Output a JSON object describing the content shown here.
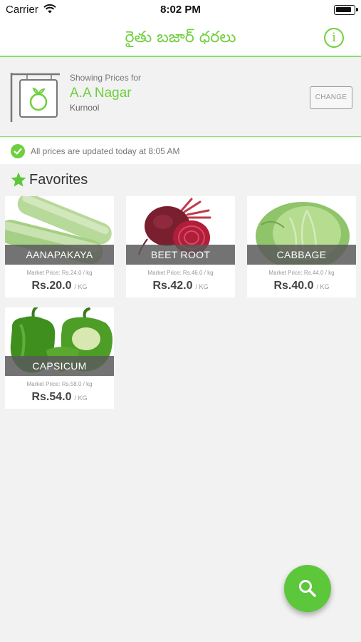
{
  "status_bar": {
    "carrier": "Carrier",
    "time": "8:02 PM"
  },
  "header": {
    "title": "రైతు బజార్ ధరలు",
    "info_icon": "info-icon"
  },
  "location": {
    "caption": "Showing Prices for",
    "market": "A.A Nagar",
    "city": "Kurnool",
    "change_label": "CHANGE"
  },
  "update": {
    "text": "All prices are updated today at 8:05 AM"
  },
  "favorites": {
    "title": "Favorites",
    "items": [
      {
        "name": "AANAPAKAYA",
        "market_price": "Market Price: Rs.24.0 / kg",
        "price": "Rs.20.0",
        "unit": "/ KG"
      },
      {
        "name": "BEET ROOT",
        "market_price": "Market Price: Rs.46.0 / kg",
        "price": "Rs.42.0",
        "unit": "/ KG"
      },
      {
        "name": "CABBAGE",
        "market_price": "Market Price: Rs.44.0 / kg",
        "price": "Rs.40.0",
        "unit": "/ KG"
      },
      {
        "name": "CAPSICUM",
        "market_price": "Market Price: Rs.58.0 / kg",
        "price": "Rs.54.0",
        "unit": "/ KG"
      }
    ]
  },
  "colors": {
    "accent": "#6fcf3e",
    "fab": "#5cc73a",
    "label_overlay": "#5a5a5a"
  },
  "icons": {
    "search": "search-icon",
    "star": "star-icon",
    "check": "check-circle-icon",
    "shop": "shop-sign-icon"
  }
}
